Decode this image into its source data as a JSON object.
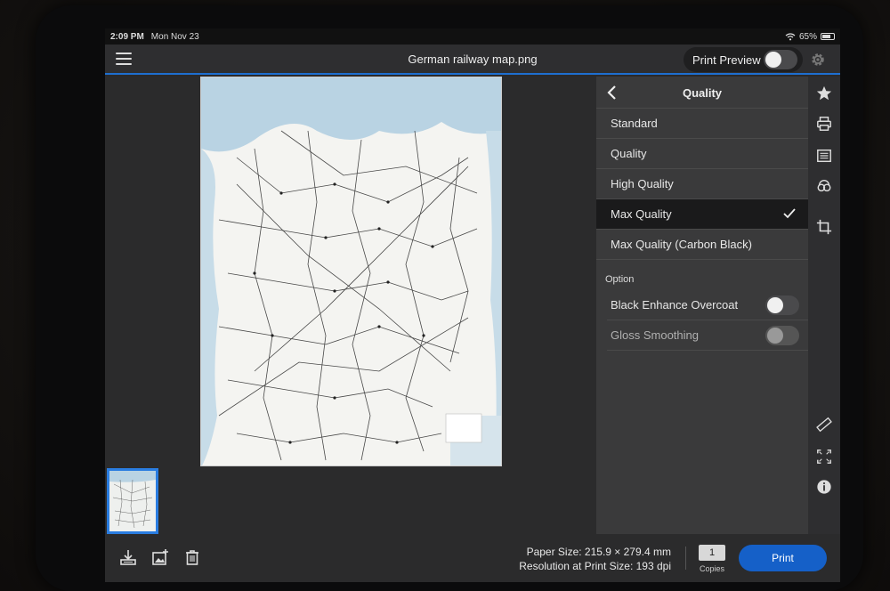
{
  "status_bar": {
    "time": "2:09 PM",
    "date": "Mon Nov 23",
    "battery": "65%"
  },
  "app_bar": {
    "title": "German railway map.png",
    "print_preview_label": "Print Preview"
  },
  "panel": {
    "title": "Quality",
    "options": [
      {
        "label": "Standard",
        "selected": false
      },
      {
        "label": "Quality",
        "selected": false
      },
      {
        "label": "High Quality",
        "selected": false
      },
      {
        "label": "Max Quality",
        "selected": true
      },
      {
        "label": "Max Quality (Carbon Black)",
        "selected": false
      }
    ],
    "option_section": "Option",
    "switches": [
      {
        "label": "Black Enhance Overcoat",
        "enabled": true
      },
      {
        "label": "Gloss Smoothing",
        "enabled": false
      }
    ]
  },
  "bottom": {
    "paper_size": "Paper Size:  215.9 × 279.4 mm",
    "resolution": "Resolution at Print Size:  193 dpi",
    "copies_value": "1",
    "copies_label": "Copies",
    "print_label": "Print"
  },
  "colors": {
    "accent": "#1e6fd0",
    "print_button": "#1560c8",
    "panel_bg": "#3a3a3b"
  }
}
